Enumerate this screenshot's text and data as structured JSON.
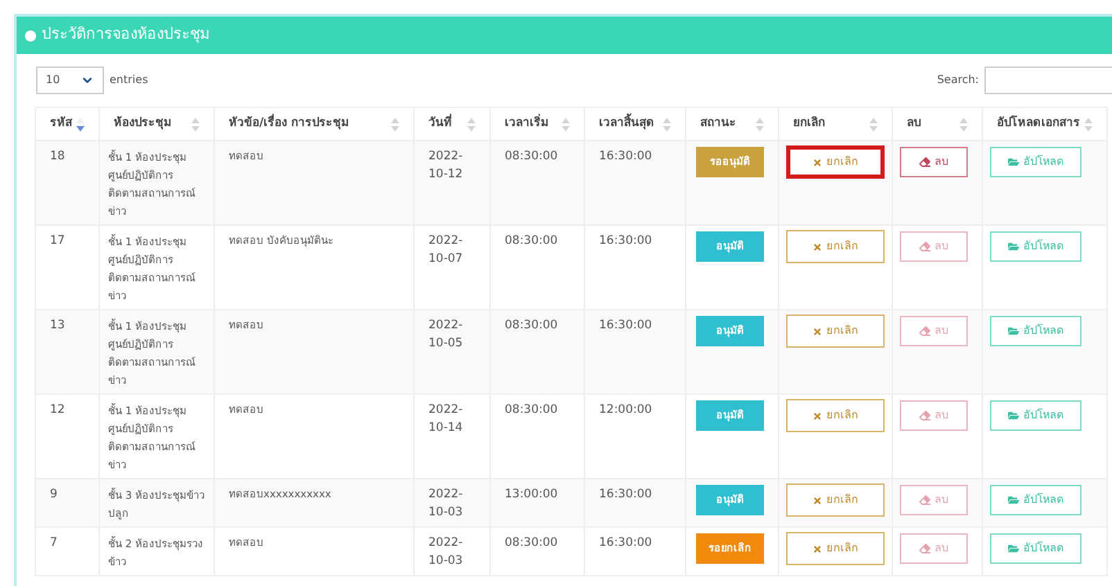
{
  "panel": {
    "title": "ประวัติการจองห้องประชุม"
  },
  "length_menu": {
    "value": "10",
    "label": "entries"
  },
  "search": {
    "label": "Search:"
  },
  "table": {
    "columns": [
      {
        "label": "รหัส",
        "sorted": true
      },
      {
        "label": "ห้องประชุม",
        "sorted": false
      },
      {
        "label": "หัวข้อ/เรื่อง การประชุม",
        "sorted": false
      },
      {
        "label": "วันที่",
        "sorted": false
      },
      {
        "label": "เวลาเริ่ม",
        "sorted": false
      },
      {
        "label": "เวลาสิ้นสุด",
        "sorted": false
      },
      {
        "label": "สถานะ",
        "sorted": false
      },
      {
        "label": "ยกเลิก",
        "sorted": false
      },
      {
        "label": "ลบ",
        "sorted": false
      },
      {
        "label": "อัปโหลดเอกสาร",
        "sorted": false
      }
    ],
    "rows": [
      {
        "id": "18",
        "room": "ชั้น 1 ห้องประชุมศูนย์ปฏิบัติการติดตามสถานการณ์ข่าว",
        "subject": "ทดสอบ",
        "date": "2022-10-12",
        "start": "08:30:00",
        "end": "16:30:00",
        "status": {
          "label": "รออนุมัติ",
          "color": "#c9a13f"
        },
        "cancel": {
          "label": "ยกเลิก",
          "highlighted": true
        },
        "delete": {
          "label": "ลบ",
          "disabled": false
        },
        "upload": {
          "label": "อัปโหลด"
        }
      },
      {
        "id": "17",
        "room": "ชั้น 1 ห้องประชุมศูนย์ปฏิบัติการติดตามสถานการณ์ข่าว",
        "subject": "ทดสอบ บังคับอนุมัตินะ",
        "date": "2022-10-07",
        "start": "08:30:00",
        "end": "16:30:00",
        "status": {
          "label": "อนุมัติ",
          "color": "#2fbfd0"
        },
        "cancel": {
          "label": "ยกเลิก",
          "highlighted": false
        },
        "delete": {
          "label": "ลบ",
          "disabled": true
        },
        "upload": {
          "label": "อัปโหลด"
        }
      },
      {
        "id": "13",
        "room": "ชั้น 1 ห้องประชุมศูนย์ปฏิบัติการติดตามสถานการณ์ข่าว",
        "subject": "ทดสอบ",
        "date": "2022-10-05",
        "start": "08:30:00",
        "end": "16:30:00",
        "status": {
          "label": "อนุมัติ",
          "color": "#2fbfd0"
        },
        "cancel": {
          "label": "ยกเลิก",
          "highlighted": false
        },
        "delete": {
          "label": "ลบ",
          "disabled": true
        },
        "upload": {
          "label": "อัปโหลด"
        }
      },
      {
        "id": "12",
        "room": "ชั้น 1 ห้องประชุมศูนย์ปฏิบัติการติดตามสถานการณ์ข่าว",
        "subject": "ทดสอบ",
        "date": "2022-10-14",
        "start": "08:30:00",
        "end": "12:00:00",
        "status": {
          "label": "อนุมัติ",
          "color": "#2fbfd0"
        },
        "cancel": {
          "label": "ยกเลิก",
          "highlighted": false
        },
        "delete": {
          "label": "ลบ",
          "disabled": true
        },
        "upload": {
          "label": "อัปโหลด"
        }
      },
      {
        "id": "9",
        "room": "ชั้น 3 ห้องประชุมข้าวปลูก",
        "subject": "ทดสอบxxxxxxxxxxx",
        "date": "2022-10-03",
        "start": "13:00:00",
        "end": "16:30:00",
        "status": {
          "label": "อนุมัติ",
          "color": "#2fbfd0"
        },
        "cancel": {
          "label": "ยกเลิก",
          "highlighted": false
        },
        "delete": {
          "label": "ลบ",
          "disabled": true
        },
        "upload": {
          "label": "อัปโหลด"
        }
      },
      {
        "id": "7",
        "room": "ชั้น 2 ห้องประชุมรวงข้าว",
        "subject": "ทดสอบ",
        "date": "2022-10-03",
        "start": "08:30:00",
        "end": "16:30:00",
        "status": {
          "label": "รอยกเลิก",
          "color": "#f0890c"
        },
        "cancel": {
          "label": "ยกเลิก",
          "highlighted": false
        },
        "delete": {
          "label": "ลบ",
          "disabled": true
        },
        "upload": {
          "label": "อัปโหลด"
        }
      }
    ]
  }
}
